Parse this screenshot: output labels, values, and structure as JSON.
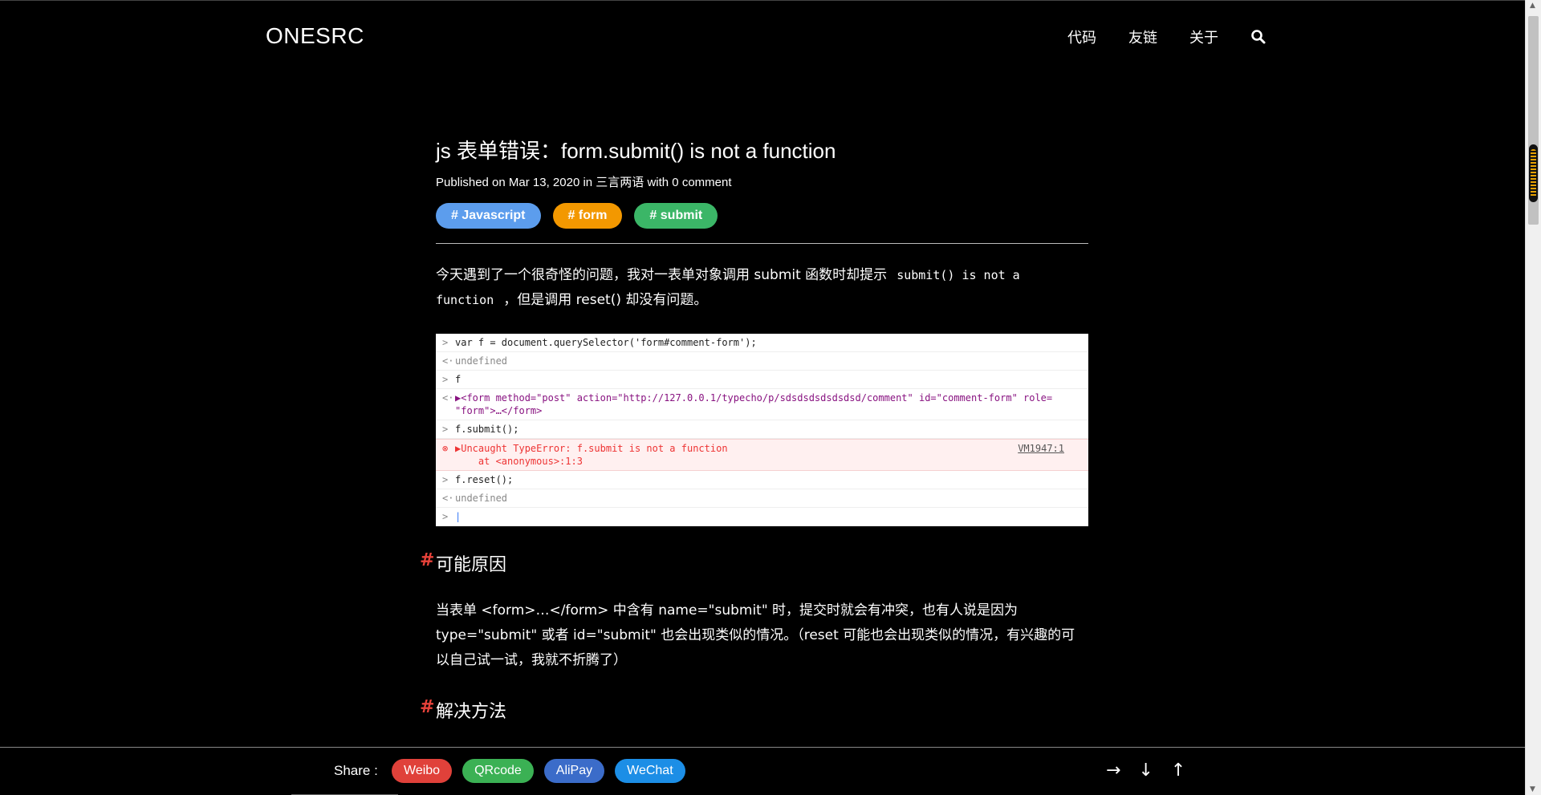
{
  "header": {
    "logo": "ONESRC",
    "nav": [
      {
        "label": "代码"
      },
      {
        "label": "友链"
      },
      {
        "label": "关于"
      }
    ]
  },
  "post": {
    "title": "js 表单错误：form.submit() is not a function",
    "meta": "Published on Mar 13, 2020 in 三言两语 with 0 comment",
    "tags": [
      {
        "label": "# Javascript",
        "color": "#5c9ded"
      },
      {
        "label": "# form",
        "color": "#f39800"
      },
      {
        "label": "# submit",
        "color": "#3bb667"
      }
    ],
    "intro_a": "今天遇到了一个很奇怪的问题，我对一表单对象调用 submit 函数时却提示",
    "intro_code": "submit() is not a function",
    "intro_b": "，但是调用 reset() 却没有问题。",
    "console": {
      "l1": "var f = document.querySelector('form#comment-form');",
      "l2": "undefined",
      "l3": "f",
      "l4a": "▶<form method=\"post\" action=\"http://127.0.0.1/typecho/p/sdsdsdsdsdsdsd/comment\" id=\"comment-form\" role=",
      "l4b": "\"form\">…</form>",
      "l5": "f.submit();",
      "l6a": "▶Uncaught TypeError: f.submit is not a function",
      "l6b": "    at <anonymous>:1:3",
      "l6src": "VM1947:1",
      "l7": "f.reset();",
      "l8": "undefined"
    },
    "section1": "可能原因",
    "para1": "当表单 <form>…</form> 中含有 name=\"submit\" 时，提交时就会有冲突，也有人说是因为 type=\"submit\" 或者 id=\"submit\" 也会出现类似的情况。（reset 可能也会出现类似的情况，有兴趣的可以自己试一试，我就不折腾了）",
    "section2": "解决方法"
  },
  "footer": {
    "share_label": "Share :",
    "share": [
      {
        "label": "Weibo",
        "color": "#e0413a"
      },
      {
        "label": "QRcode",
        "color": "#3bb154"
      },
      {
        "label": "AliPay",
        "color": "#3b6cc9"
      },
      {
        "label": "WeChat",
        "color": "#1c8ee6"
      }
    ],
    "arrows": [
      "→",
      "↓",
      "↑"
    ]
  }
}
